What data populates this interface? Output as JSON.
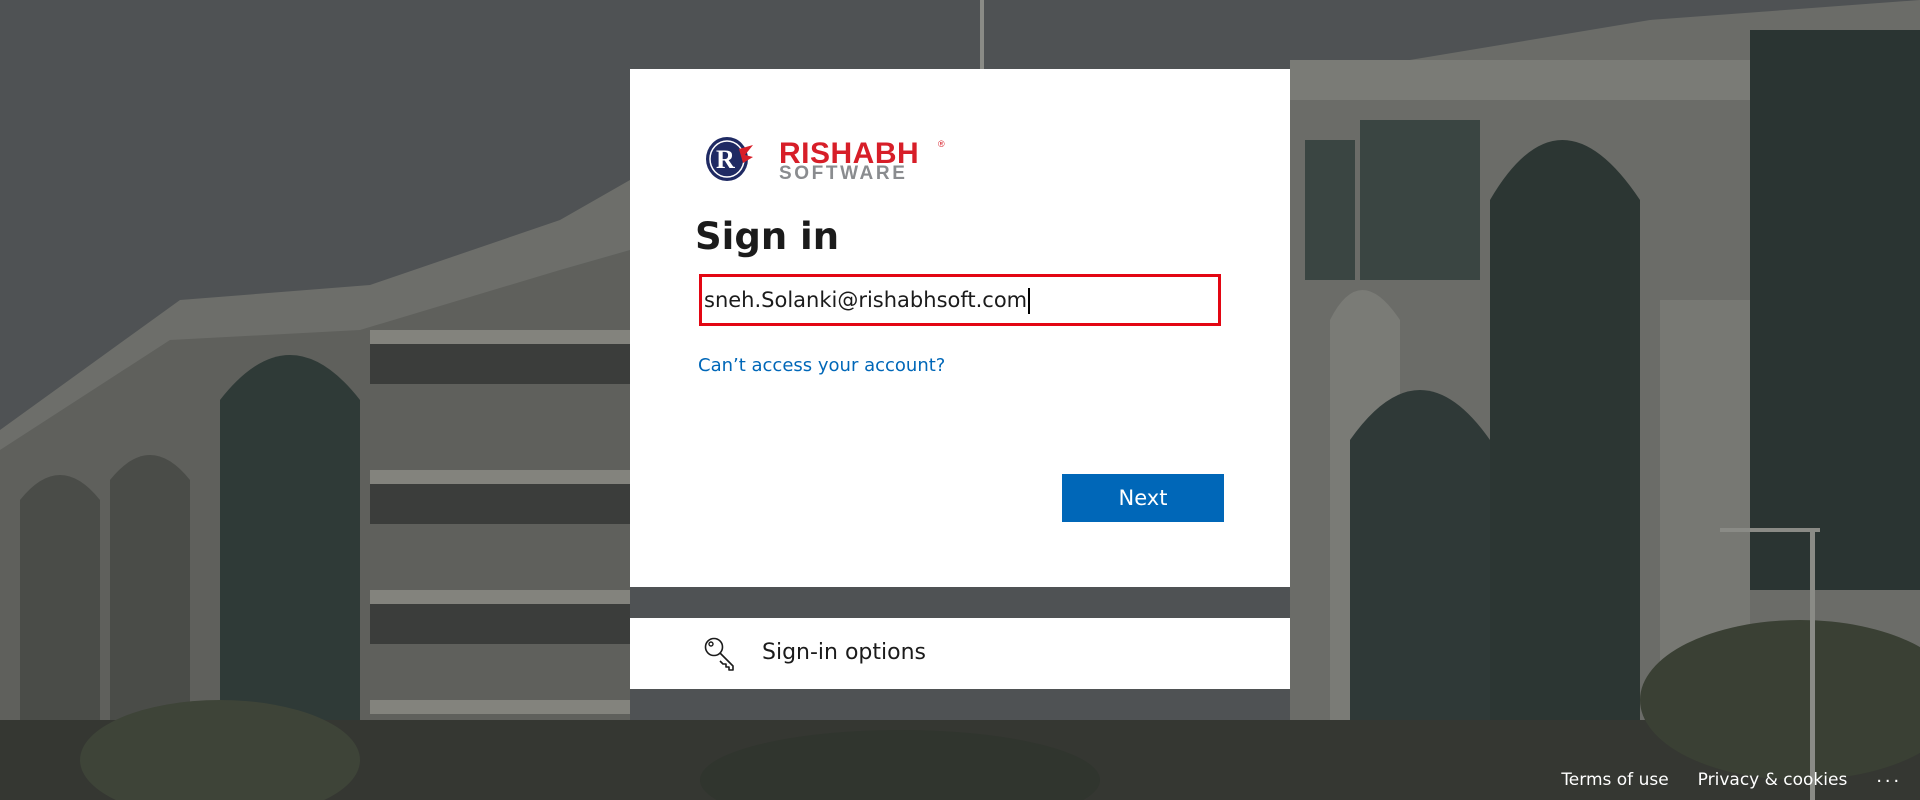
{
  "logo": {
    "brand_line1": "RISHABH",
    "brand_line2": "SOFTWARE",
    "registered_mark": "®",
    "monogram": "R"
  },
  "signin": {
    "title": "Sign in",
    "email_value": "sneh.Solanki@rishabhsoft.com",
    "cant_access_link": "Can’t access your account?",
    "next_button": "Next"
  },
  "signin_options": {
    "label": "Sign-in options",
    "icon": "key-icon"
  },
  "footer": {
    "terms": "Terms of use",
    "privacy": "Privacy & cookies",
    "more": "..."
  },
  "colors": {
    "primary_blue": "#0067b8",
    "highlight_red": "#e30613",
    "brand_red": "#d71e28",
    "brand_navy": "#1f2a63"
  }
}
